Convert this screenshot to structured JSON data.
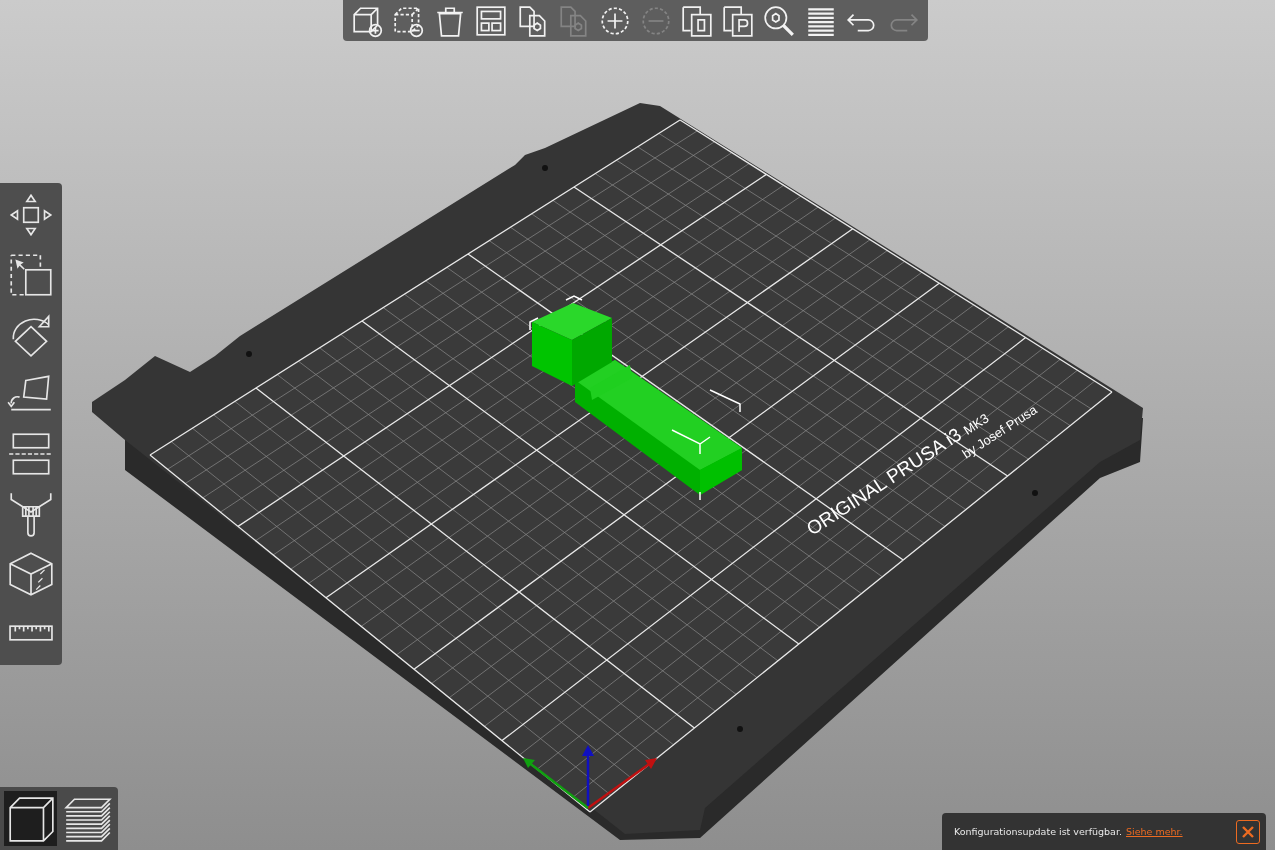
{
  "top_toolbar": [
    {
      "kind": "add",
      "disabled": false
    },
    {
      "kind": "delete",
      "disabled": false
    },
    {
      "kind": "delete_all",
      "disabled": false
    },
    {
      "kind": "arrange",
      "disabled": false
    },
    {
      "kind": "copy",
      "disabled": false
    },
    {
      "kind": "paste",
      "disabled": true
    },
    {
      "kind": "add_instance",
      "disabled": false
    },
    {
      "kind": "remove_instance",
      "disabled": true
    },
    {
      "kind": "split_objects",
      "disabled": false
    },
    {
      "kind": "split_parts",
      "disabled": false
    },
    {
      "kind": "search",
      "disabled": false
    },
    {
      "kind": "layers",
      "disabled": false
    },
    {
      "kind": "undo",
      "disabled": false
    },
    {
      "kind": "redo",
      "disabled": true
    }
  ],
  "gizmo_toolbar": [
    {
      "kind": "move"
    },
    {
      "kind": "scale"
    },
    {
      "kind": "rotate"
    },
    {
      "kind": "place_on_face"
    },
    {
      "kind": "cut"
    },
    {
      "kind": "paint_supports"
    },
    {
      "kind": "seam"
    },
    {
      "kind": "measure"
    }
  ],
  "view_toggle": [
    {
      "kind": "model",
      "selected": true
    },
    {
      "kind": "preview",
      "selected": false
    }
  ],
  "bed_label": {
    "title": "ORIGINAL PRUSA i3",
    "model": "MK3",
    "subtitle": "by Josef Prusa"
  },
  "notification": {
    "text": "Konfigurationsupdate ist verfügbar.",
    "link": "Siehe mehr."
  }
}
